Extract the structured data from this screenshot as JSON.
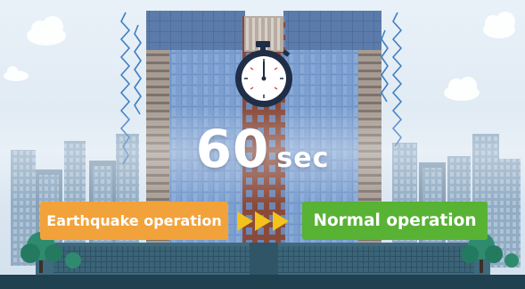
{
  "timer": {
    "value": "60",
    "unit": "sec"
  },
  "transition": {
    "from_label": "Earthquake operation",
    "to_label": "Normal operation"
  },
  "icons": [
    "stopwatch-icon",
    "triple-arrow-right-icon",
    "cloud-icon",
    "tree-icon",
    "vibration-line-icon"
  ],
  "colors": {
    "from_bg": "#f2a23a",
    "to_bg": "#58b234",
    "arrow": "#f3c21c",
    "sky": "#dce7f1",
    "ground": "#1f4150"
  }
}
